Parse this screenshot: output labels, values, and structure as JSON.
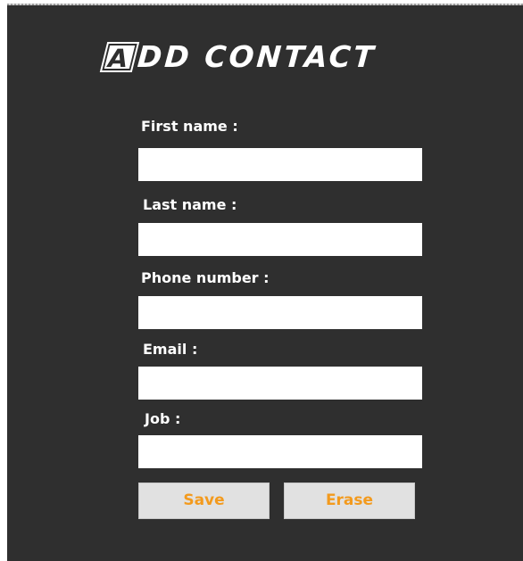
{
  "form": {
    "title_badge": "A",
    "title_rest": "DD CONTACT",
    "fields": [
      {
        "label": "First name :",
        "value": "",
        "placeholder": ""
      },
      {
        "label": "Last name :",
        "value": "",
        "placeholder": ""
      },
      {
        "label": "Phone number :",
        "value": "",
        "placeholder": ""
      },
      {
        "label": "Email :",
        "value": "",
        "placeholder": ""
      },
      {
        "label": "Job :",
        "value": "",
        "placeholder": ""
      }
    ],
    "save_label": "Save",
    "erase_label": "Erase"
  },
  "colors": {
    "panel_background": "#2f2f2f",
    "label_text": "#ffffff",
    "button_background": "#e1e1e1",
    "button_text": "#f39a1d"
  }
}
